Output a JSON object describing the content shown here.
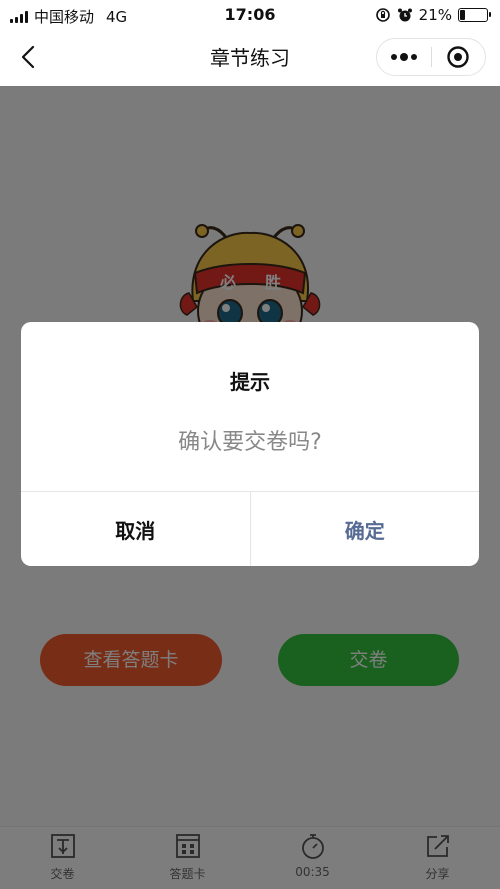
{
  "status_bar": {
    "carrier": "中国移动",
    "network": "4G",
    "time": "17:06",
    "battery": "21%",
    "battery_level": 0.21
  },
  "nav": {
    "title": "章节练习",
    "back_icon": "chevron-left-icon",
    "more_icon": "more-dots-icon",
    "close_icon": "target-circle-icon"
  },
  "mascot": {
    "headband_left": "必",
    "headband_right": "胜"
  },
  "actions": {
    "view_card": "查看答题卡",
    "submit": "交卷"
  },
  "tab_bar": {
    "items": [
      {
        "label": "交卷",
        "icon": "submit-icon"
      },
      {
        "label": "答题卡",
        "icon": "answer-card-icon"
      },
      {
        "label": "00:35",
        "icon": "stopwatch-icon"
      },
      {
        "label": "分享",
        "icon": "share-icon"
      }
    ]
  },
  "dialog": {
    "title": "提示",
    "message": "确认要交卷吗?",
    "cancel": "取消",
    "confirm": "确定"
  },
  "colors": {
    "confirm": "#576b95",
    "view_card_button": "#f15a2c",
    "submit_button": "#34c23e"
  }
}
